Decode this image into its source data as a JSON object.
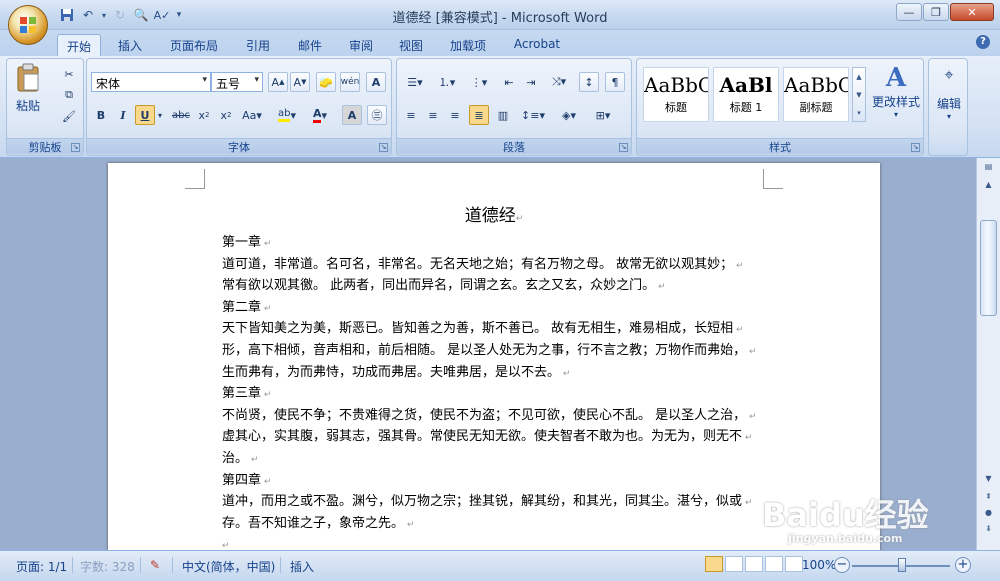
{
  "window": {
    "title": "道德经 [兼容模式] - Microsoft Word"
  },
  "tabs": [
    {
      "label": "开始",
      "active": true
    },
    {
      "label": "插入"
    },
    {
      "label": "页面布局"
    },
    {
      "label": "引用"
    },
    {
      "label": "邮件"
    },
    {
      "label": "审阅"
    },
    {
      "label": "视图"
    },
    {
      "label": "加载项"
    },
    {
      "label": "Acrobat"
    }
  ],
  "ribbon": {
    "clipboard": {
      "label": "剪贴板",
      "paste": "粘贴"
    },
    "font": {
      "label": "字体",
      "font_name": "宋体",
      "font_size": "五号",
      "wen": "wén",
      "ab_clear": "Aa"
    },
    "paragraph": {
      "label": "段落"
    },
    "styles": {
      "label": "样式",
      "items": [
        {
          "sample": "AaBbC",
          "name": "标题"
        },
        {
          "sample": "AaBl",
          "name": "标题 1"
        },
        {
          "sample": "AaBbC",
          "name": "副标题"
        }
      ],
      "change_styles": "更改样式"
    },
    "editing": {
      "label": "编辑"
    }
  },
  "document": {
    "title": "道德经",
    "lines": [
      "第一章",
      "道可道，非常道。名可名，非常名。无名天地之始；有名万物之母。 故常无欲以观其妙；",
      "常有欲以观其徼。 此两者，同出而异名，同谓之玄。玄之又玄，众妙之门。",
      "第二章",
      "天下皆知美之为美，斯恶已。皆知善之为善，斯不善已。 故有无相生，难易相成，长短相",
      "形，高下相倾，音声相和，前后相随。 是以圣人处无为之事，行不言之教；万物作而弗始，",
      "生而弗有，为而弗恃，功成而弗居。夫唯弗居，是以不去。",
      "第三章",
      "不尚贤，使民不争；不贵难得之货，使民不为盗；不见可欲，使民心不乱。 是以圣人之治，",
      "虚其心，实其腹，弱其志，强其骨。常使民无知无欲。使夫智者不敢为也。为无为，则无不",
      "治。",
      "第四章",
      "道冲，而用之或不盈。渊兮，似万物之宗；挫其锐，解其纷，和其光，同其尘。湛兮，似或",
      "存。吾不知谁之子，象帝之先。",
      ""
    ]
  },
  "status": {
    "page": "页面: 1/1",
    "words": "字数: 328",
    "language": "中文(简体，中国)",
    "insert": "插入",
    "zoom": "100%"
  },
  "watermark": {
    "text": "Baidu经验",
    "sub": "jingyan.baidu.com"
  }
}
